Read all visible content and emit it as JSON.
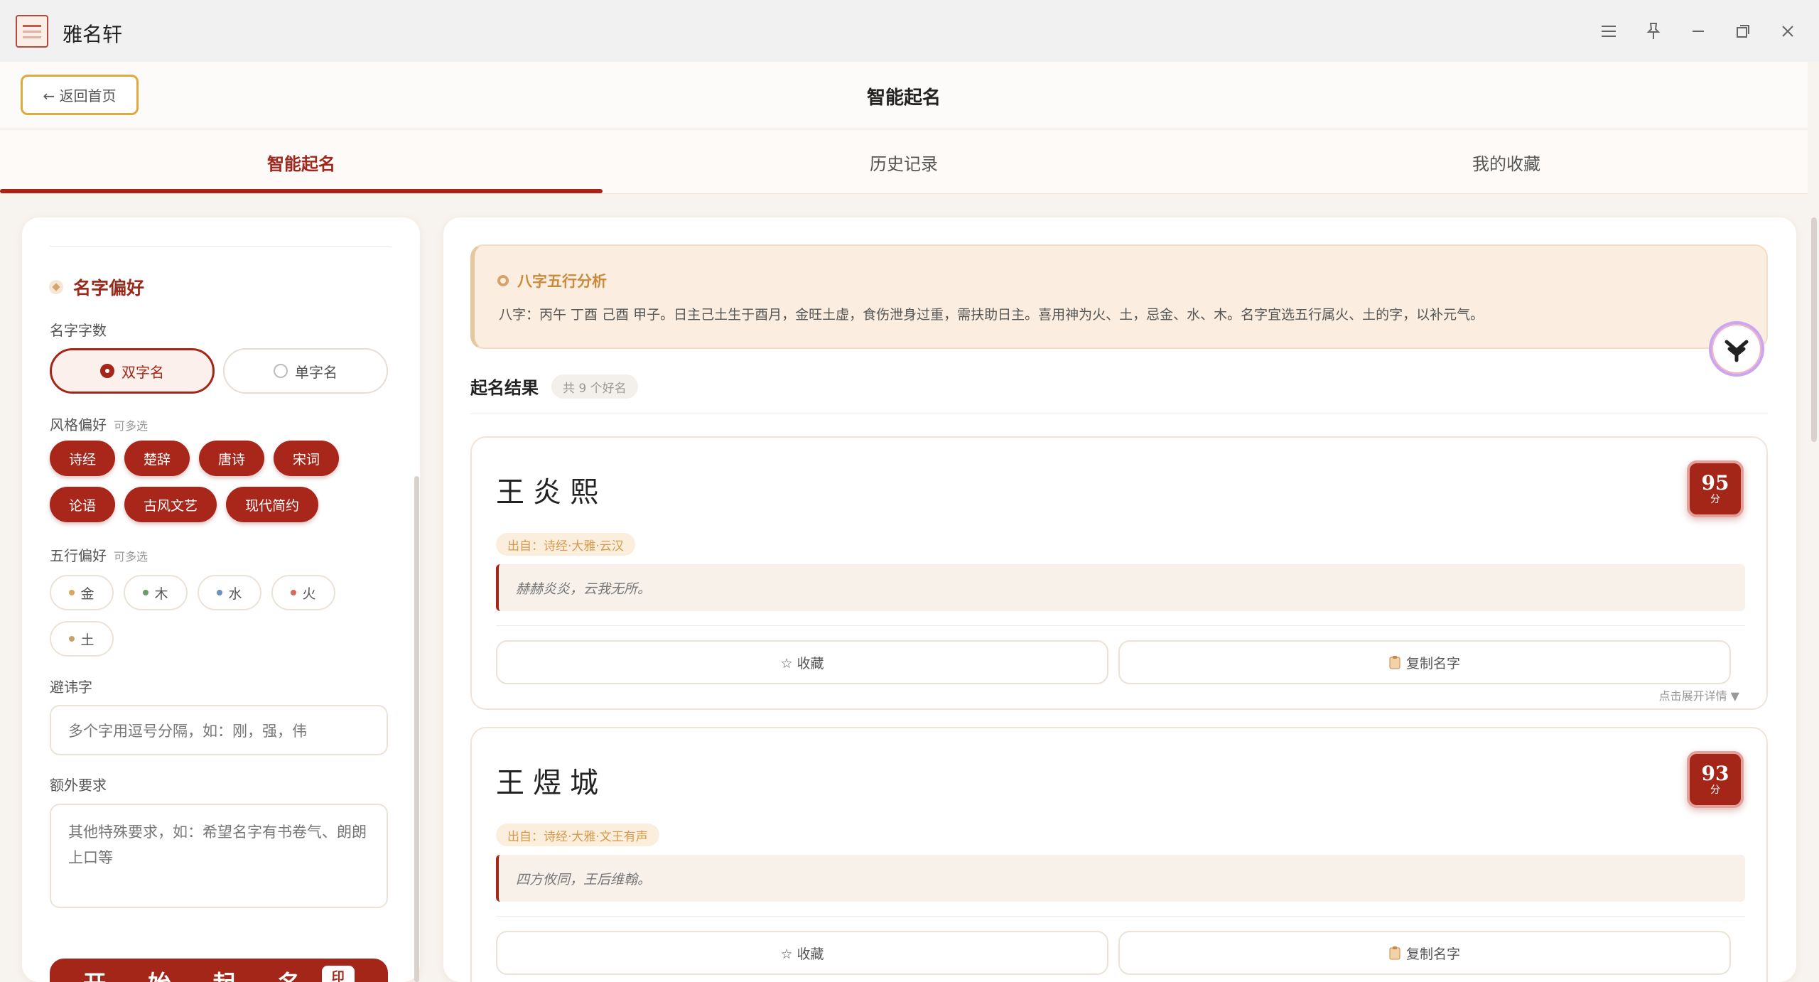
{
  "app": {
    "title": "雅名轩"
  },
  "window_controls": {
    "menu": "☰",
    "pin": "📌",
    "minimize": "—",
    "maximize": "❐",
    "close": "✕"
  },
  "header": {
    "back_label": "← 返回首页",
    "page_title": "智能起名"
  },
  "tabs": [
    {
      "label": "智能起名",
      "active": true
    },
    {
      "label": "历史记录",
      "active": false
    },
    {
      "label": "我的收藏",
      "active": false
    }
  ],
  "preferences": {
    "section_title": "名字偏好",
    "count_label": "名字字数",
    "count_options": [
      {
        "label": "双字名",
        "selected": true
      },
      {
        "label": "单字名",
        "selected": false
      }
    ],
    "style_label": "风格偏好",
    "style_hint": "可多选",
    "styles": [
      "诗经",
      "楚辞",
      "唐诗",
      "宋词",
      "论语",
      "古风文艺",
      "现代简约"
    ],
    "wuxing_label": "五行偏好",
    "wuxing_hint": "可多选",
    "wuxing": [
      {
        "label": "金",
        "color": "#d9a762"
      },
      {
        "label": "木",
        "color": "#6a9c6a"
      },
      {
        "label": "水",
        "color": "#6a8fc4"
      },
      {
        "label": "火",
        "color": "#d96a5a"
      },
      {
        "label": "土",
        "color": "#c9a26a"
      }
    ],
    "avoid_label": "避讳字",
    "avoid_placeholder": "多个字用逗号分隔，如：刚，强，伟",
    "extra_label": "额外要求",
    "extra_placeholder": "其他特殊要求，如：希望名字有书卷气、朗朗上口等",
    "start_label": "开 始 起 名",
    "start_seal": "印"
  },
  "bazi": {
    "title": "八字五行分析",
    "text": "八字：丙午 丁酉 己酉 甲子。日主己土生于酉月，金旺土虚，食伤泄身过重，需扶助日主。喜用神为火、土，忌金、水、木。名字宜选五行属火、土的字，以补元气。"
  },
  "results": {
    "title": "起名结果",
    "count": "共 9 个好名",
    "expand_hint": "点击展开详情 ▼",
    "favorite_label": "☆ 收藏",
    "copy_label": "复制名字",
    "items": [
      {
        "name": "王炎熙",
        "score": "95",
        "score_unit": "分",
        "source": "出自：诗经·大雅·云汉",
        "quote": "赫赫炎炎，云我无所。"
      },
      {
        "name": "王煜城",
        "score": "93",
        "score_unit": "分",
        "source": "出自：诗经·大雅·文王有声",
        "quote": "四方攸同，王后维翰。"
      }
    ]
  },
  "colors": {
    "primary": "#a32619",
    "accent": "#e2a93c",
    "bazi_bg": "#fbeee0"
  }
}
